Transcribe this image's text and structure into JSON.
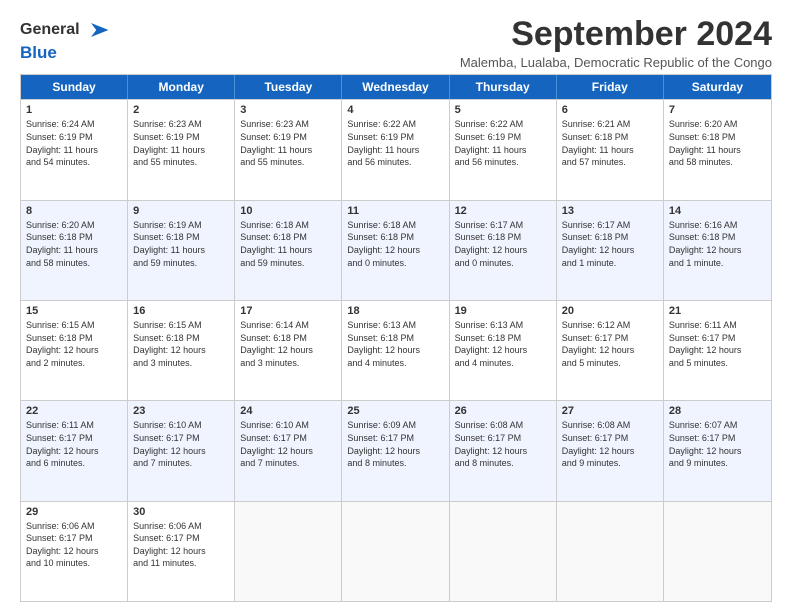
{
  "logo": {
    "line1": "General",
    "line2": "Blue",
    "arrow_color": "#1565c0"
  },
  "title": "September 2024",
  "subtitle": "Malemba, Lualaba, Democratic Republic of the Congo",
  "header_days": [
    "Sunday",
    "Monday",
    "Tuesday",
    "Wednesday",
    "Thursday",
    "Friday",
    "Saturday"
  ],
  "weeks": [
    [
      {
        "day": "1",
        "lines": [
          "Sunrise: 6:24 AM",
          "Sunset: 6:19 PM",
          "Daylight: 11 hours",
          "and 54 minutes."
        ]
      },
      {
        "day": "2",
        "lines": [
          "Sunrise: 6:23 AM",
          "Sunset: 6:19 PM",
          "Daylight: 11 hours",
          "and 55 minutes."
        ]
      },
      {
        "day": "3",
        "lines": [
          "Sunrise: 6:23 AM",
          "Sunset: 6:19 PM",
          "Daylight: 11 hours",
          "and 55 minutes."
        ]
      },
      {
        "day": "4",
        "lines": [
          "Sunrise: 6:22 AM",
          "Sunset: 6:19 PM",
          "Daylight: 11 hours",
          "and 56 minutes."
        ]
      },
      {
        "day": "5",
        "lines": [
          "Sunrise: 6:22 AM",
          "Sunset: 6:19 PM",
          "Daylight: 11 hours",
          "and 56 minutes."
        ]
      },
      {
        "day": "6",
        "lines": [
          "Sunrise: 6:21 AM",
          "Sunset: 6:18 PM",
          "Daylight: 11 hours",
          "and 57 minutes."
        ]
      },
      {
        "day": "7",
        "lines": [
          "Sunrise: 6:20 AM",
          "Sunset: 6:18 PM",
          "Daylight: 11 hours",
          "and 58 minutes."
        ]
      }
    ],
    [
      {
        "day": "8",
        "lines": [
          "Sunrise: 6:20 AM",
          "Sunset: 6:18 PM",
          "Daylight: 11 hours",
          "and 58 minutes."
        ]
      },
      {
        "day": "9",
        "lines": [
          "Sunrise: 6:19 AM",
          "Sunset: 6:18 PM",
          "Daylight: 11 hours",
          "and 59 minutes."
        ]
      },
      {
        "day": "10",
        "lines": [
          "Sunrise: 6:18 AM",
          "Sunset: 6:18 PM",
          "Daylight: 11 hours",
          "and 59 minutes."
        ]
      },
      {
        "day": "11",
        "lines": [
          "Sunrise: 6:18 AM",
          "Sunset: 6:18 PM",
          "Daylight: 12 hours",
          "and 0 minutes."
        ]
      },
      {
        "day": "12",
        "lines": [
          "Sunrise: 6:17 AM",
          "Sunset: 6:18 PM",
          "Daylight: 12 hours",
          "and 0 minutes."
        ]
      },
      {
        "day": "13",
        "lines": [
          "Sunrise: 6:17 AM",
          "Sunset: 6:18 PM",
          "Daylight: 12 hours",
          "and 1 minute."
        ]
      },
      {
        "day": "14",
        "lines": [
          "Sunrise: 6:16 AM",
          "Sunset: 6:18 PM",
          "Daylight: 12 hours",
          "and 1 minute."
        ]
      }
    ],
    [
      {
        "day": "15",
        "lines": [
          "Sunrise: 6:15 AM",
          "Sunset: 6:18 PM",
          "Daylight: 12 hours",
          "and 2 minutes."
        ]
      },
      {
        "day": "16",
        "lines": [
          "Sunrise: 6:15 AM",
          "Sunset: 6:18 PM",
          "Daylight: 12 hours",
          "and 3 minutes."
        ]
      },
      {
        "day": "17",
        "lines": [
          "Sunrise: 6:14 AM",
          "Sunset: 6:18 PM",
          "Daylight: 12 hours",
          "and 3 minutes."
        ]
      },
      {
        "day": "18",
        "lines": [
          "Sunrise: 6:13 AM",
          "Sunset: 6:18 PM",
          "Daylight: 12 hours",
          "and 4 minutes."
        ]
      },
      {
        "day": "19",
        "lines": [
          "Sunrise: 6:13 AM",
          "Sunset: 6:18 PM",
          "Daylight: 12 hours",
          "and 4 minutes."
        ]
      },
      {
        "day": "20",
        "lines": [
          "Sunrise: 6:12 AM",
          "Sunset: 6:17 PM",
          "Daylight: 12 hours",
          "and 5 minutes."
        ]
      },
      {
        "day": "21",
        "lines": [
          "Sunrise: 6:11 AM",
          "Sunset: 6:17 PM",
          "Daylight: 12 hours",
          "and 5 minutes."
        ]
      }
    ],
    [
      {
        "day": "22",
        "lines": [
          "Sunrise: 6:11 AM",
          "Sunset: 6:17 PM",
          "Daylight: 12 hours",
          "and 6 minutes."
        ]
      },
      {
        "day": "23",
        "lines": [
          "Sunrise: 6:10 AM",
          "Sunset: 6:17 PM",
          "Daylight: 12 hours",
          "and 7 minutes."
        ]
      },
      {
        "day": "24",
        "lines": [
          "Sunrise: 6:10 AM",
          "Sunset: 6:17 PM",
          "Daylight: 12 hours",
          "and 7 minutes."
        ]
      },
      {
        "day": "25",
        "lines": [
          "Sunrise: 6:09 AM",
          "Sunset: 6:17 PM",
          "Daylight: 12 hours",
          "and 8 minutes."
        ]
      },
      {
        "day": "26",
        "lines": [
          "Sunrise: 6:08 AM",
          "Sunset: 6:17 PM",
          "Daylight: 12 hours",
          "and 8 minutes."
        ]
      },
      {
        "day": "27",
        "lines": [
          "Sunrise: 6:08 AM",
          "Sunset: 6:17 PM",
          "Daylight: 12 hours",
          "and 9 minutes."
        ]
      },
      {
        "day": "28",
        "lines": [
          "Sunrise: 6:07 AM",
          "Sunset: 6:17 PM",
          "Daylight: 12 hours",
          "and 9 minutes."
        ]
      }
    ],
    [
      {
        "day": "29",
        "lines": [
          "Sunrise: 6:06 AM",
          "Sunset: 6:17 PM",
          "Daylight: 12 hours",
          "and 10 minutes."
        ]
      },
      {
        "day": "30",
        "lines": [
          "Sunrise: 6:06 AM",
          "Sunset: 6:17 PM",
          "Daylight: 12 hours",
          "and 11 minutes."
        ]
      },
      {
        "day": "",
        "lines": []
      },
      {
        "day": "",
        "lines": []
      },
      {
        "day": "",
        "lines": []
      },
      {
        "day": "",
        "lines": []
      },
      {
        "day": "",
        "lines": []
      }
    ]
  ]
}
